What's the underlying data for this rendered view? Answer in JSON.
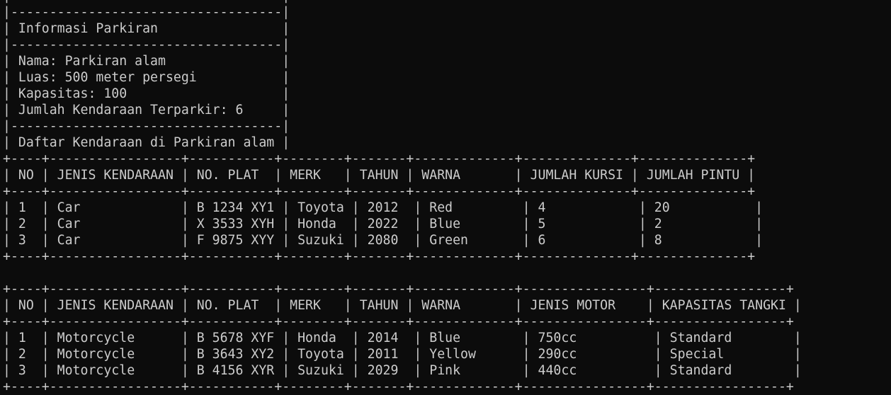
{
  "terminal": {
    "lines": [
      "|-----------------------------------|",
      "|-----------------------------------|",
      "| Informasi Parkiran                |",
      "|-----------------------------------|",
      "| Nama: Parkiran alam               |",
      "| Luas: 500 meter persegi           |",
      "| Kapasitas: 100                    |",
      "| Jumlah Kendaraan Terparkir: 6     |",
      "|-----------------------------------|",
      "| Daftar Kendaraan di Parkiran alam |",
      "+----+-----------------+-----------+--------+-------+-------------+--------------+--------------+",
      "| NO | JENIS KENDARAAN | NO. PLAT  | MERK   | TAHUN | WARNA       | JUMLAH KURSI | JUMLAH PINTU |",
      "+----+-----------------+-----------+--------+-------+-------------+--------------+--------------+",
      "| 1  | Car             | B 1234 XY1 | Toyota | 2012  | Red         | 4            | 20           |",
      "| 2  | Car             | X 3533 XYH | Honda  | 2022  | Blue        | 5            | 2            |",
      "| 3  | Car             | F 9875 XYY | Suzuki | 2080  | Green       | 6            | 8            |",
      "+----+-----------------+-----------+--------+-------+-------------+--------------+--------------+",
      "",
      "+----+-----------------+-----------+--------+-------+-------------+----------------+-----------------+",
      "| NO | JENIS KENDARAAN | NO. PLAT  | MERK   | TAHUN | WARNA       | JENIS MOTOR    | KAPASITAS TANGKI |",
      "+----+-----------------+-----------+--------+-------+-------------+----------------+-----------------+",
      "| 1  | Motorcycle      | B 5678 XYF | Honda  | 2014  | Blue        | 750cc          | Standard        |",
      "| 2  | Motorcycle      | B 3643 XY2 | Toyota | 2011  | Yellow      | 290cc          | Special         |",
      "| 3  | Motorcycle      | B 4156 XYR | Suzuki | 2029  | Pink        | 440cc          | Standard        |",
      "+----+-----------------+-----------+--------+-------+-------------+----------------+-----------------+"
    ]
  }
}
